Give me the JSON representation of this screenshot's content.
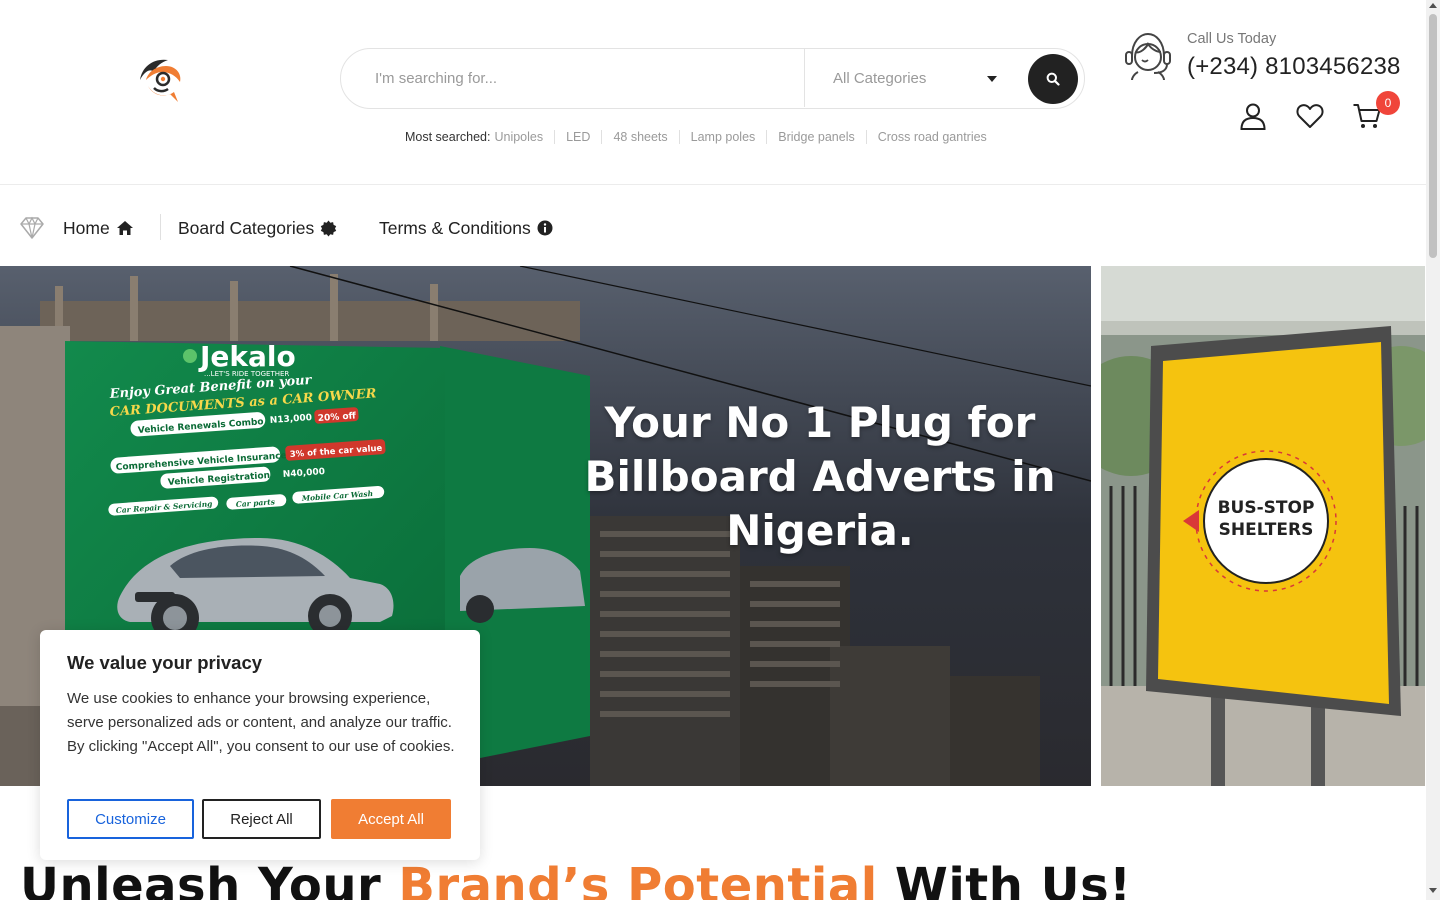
{
  "header": {
    "search_placeholder": "I'm searching for...",
    "category_selected": "All Categories",
    "most_searched_label": "Most searched:",
    "most_searched": [
      "Unipoles",
      "LED",
      "48 sheets",
      "Lamp poles",
      "Bridge panels",
      "Cross road gantries"
    ],
    "call_label": "Call Us Today",
    "call_number": "(+234) 8103456238",
    "cart_count": "0",
    "colors": {
      "accent": "#f07d33",
      "badge": "#f0453a",
      "dark": "#222222"
    }
  },
  "nav": {
    "items": [
      {
        "label": "Home",
        "icon": "home-icon"
      },
      {
        "label": "Board Categories",
        "icon": "badge-icon"
      },
      {
        "label": "Terms & Conditions",
        "icon": "info-icon"
      }
    ]
  },
  "hero": {
    "heading_line1": "Your No 1 Plug for",
    "heading_line2": "Billboard Adverts in",
    "heading_line3": "Nigeria.",
    "billboard_brand": "Jekalo",
    "billboard_tagline": "...LET'S RIDE TOGETHER",
    "billboard_headline1": "Enjoy Great Benefit on your",
    "billboard_headline2": "CAR DOCUMENTS as a CAR OWNER",
    "billboard_line1": "Vehicle Renewals Combo",
    "billboard_price1": "N13,000",
    "billboard_discount": "20% off",
    "billboard_line2": "Comprehensive Vehicle Insurance",
    "billboard_note": "3% of the car value",
    "billboard_line3": "Vehicle Registration",
    "billboard_price3": "N40,000",
    "billboard_chip1": "Car Repair & Servicing",
    "billboard_chip2": "Car parts",
    "billboard_chip3": "Mobile Car Wash",
    "side_line1": "BUS-STOP",
    "side_line2": "SHELTERS"
  },
  "cookie": {
    "title": "We value your privacy",
    "text": "We use cookies to enhance your browsing experience, serve personalized ads or content, and analyze our traffic. By clicking \"Accept All\", you consent to our use of cookies.",
    "customize": "Customize",
    "reject": "Reject All",
    "accept": "Accept All"
  },
  "tagline": {
    "part1": "Unleash Your ",
    "part2": "Brand’s Potential",
    "part3": " With Us!"
  }
}
